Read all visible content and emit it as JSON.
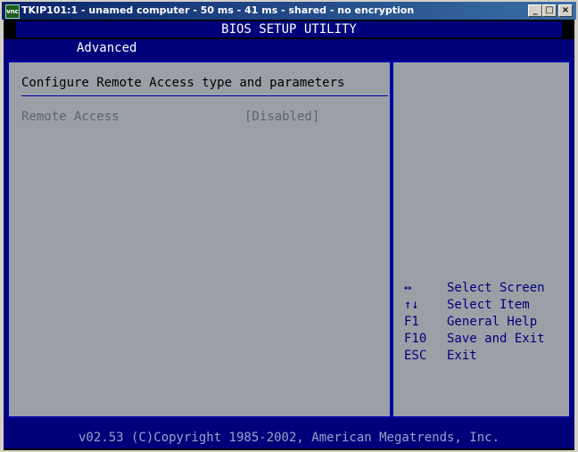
{
  "window": {
    "title": "TKIP101:1 - unamed computer - 50 ms - 41 ms - shared - no encryption",
    "icon_text": "vnc",
    "buttons": {
      "minimize": "_",
      "maximize": "□",
      "close": "×"
    }
  },
  "bios": {
    "title": "BIOS SETUP UTILITY",
    "active_tab": "Advanced",
    "heading": "Configure Remote Access type and parameters",
    "options": [
      {
        "label": "Remote Access",
        "value": "[Disabled]"
      }
    ],
    "keys": [
      {
        "key": "↔",
        "desc": "Select Screen"
      },
      {
        "key": "↑↓",
        "desc": "Select Item"
      },
      {
        "key": "F1",
        "desc": "General Help"
      },
      {
        "key": "F10",
        "desc": "Save and Exit"
      },
      {
        "key": "ESC",
        "desc": "Exit"
      }
    ],
    "footer": "v02.53 (C)Copyright 1985-2002, American Megatrends, Inc."
  },
  "colors": {
    "bios_blue": "#00007a",
    "panel_gray": "#9aa0a6",
    "title_bar": "#0a246a"
  }
}
